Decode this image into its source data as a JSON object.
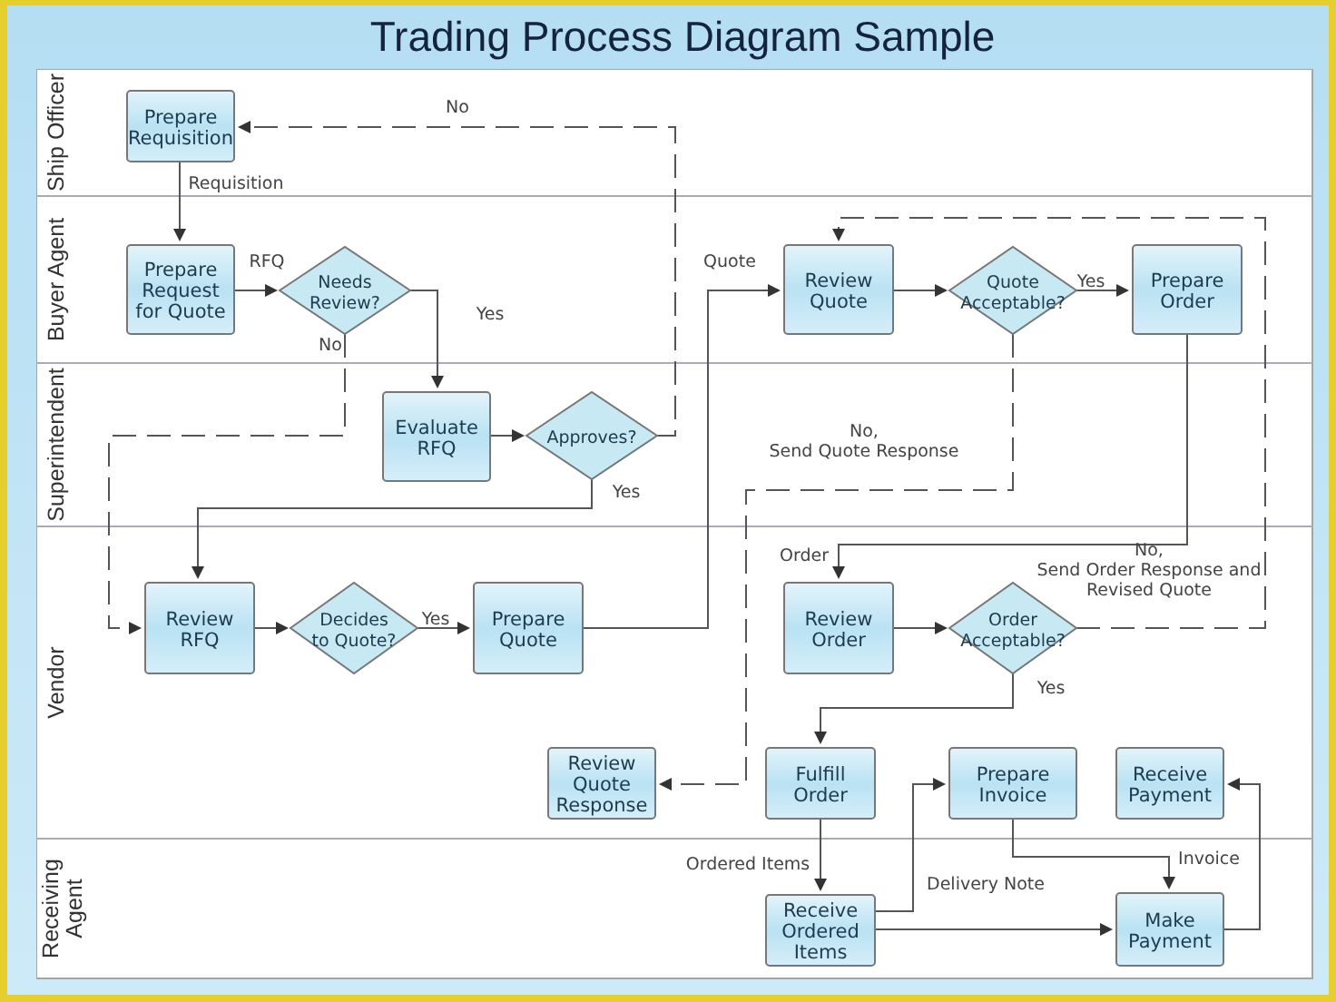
{
  "title": "Trading Process Diagram Sample",
  "lanes": [
    {
      "label": [
        "Ship Officer"
      ]
    },
    {
      "label": [
        "Buyer Agent"
      ]
    },
    {
      "label": [
        "Superintendent"
      ]
    },
    {
      "label": [
        "Vendor"
      ]
    },
    {
      "label": [
        "Receiving",
        "Agent"
      ]
    }
  ],
  "nodes": [
    {
      "kind": "process",
      "lines": [
        "Prepare",
        "Requisition"
      ]
    },
    {
      "kind": "process",
      "lines": [
        "Prepare",
        "Request",
        "for Quote"
      ]
    },
    {
      "kind": "decision",
      "lines": [
        "Needs",
        "Review?"
      ]
    },
    {
      "kind": "process",
      "lines": [
        "Evaluate",
        "RFQ"
      ]
    },
    {
      "kind": "decision",
      "lines": [
        "Approves?"
      ]
    },
    {
      "kind": "process",
      "lines": [
        "Review",
        "RFQ"
      ]
    },
    {
      "kind": "decision",
      "lines": [
        "Decides",
        "to Quote?"
      ]
    },
    {
      "kind": "process",
      "lines": [
        "Prepare",
        "Quote"
      ]
    },
    {
      "kind": "process",
      "lines": [
        "Review",
        "Quote",
        "Response"
      ]
    },
    {
      "kind": "process",
      "lines": [
        "Review",
        "Quote"
      ]
    },
    {
      "kind": "decision",
      "lines": [
        "Quote",
        "Acceptable?"
      ]
    },
    {
      "kind": "process",
      "lines": [
        "Prepare",
        "Order"
      ]
    },
    {
      "kind": "process",
      "lines": [
        "Review",
        "Order"
      ]
    },
    {
      "kind": "decision",
      "lines": [
        "Order",
        "Acceptable?"
      ]
    },
    {
      "kind": "process",
      "lines": [
        "Fulfill",
        "Order"
      ]
    },
    {
      "kind": "process",
      "lines": [
        "Prepare",
        "Invoice"
      ]
    },
    {
      "kind": "process",
      "lines": [
        "Receive",
        "Payment"
      ]
    },
    {
      "kind": "process",
      "lines": [
        "Receive",
        "Ordered",
        "Items"
      ]
    },
    {
      "kind": "process",
      "lines": [
        "Make",
        "Payment"
      ]
    }
  ],
  "edges": [
    {
      "kind": "solid",
      "label": [
        "Requisition"
      ]
    },
    {
      "kind": "solid",
      "label": [
        "RFQ"
      ]
    },
    {
      "kind": "solid",
      "label": [
        "Yes"
      ]
    },
    {
      "kind": "dashed",
      "label": [
        "No"
      ]
    },
    {
      "kind": "solid"
    },
    {
      "kind": "solid",
      "label": [
        "Yes"
      ]
    },
    {
      "kind": "dashed",
      "label": [
        "No"
      ]
    },
    {
      "kind": "solid"
    },
    {
      "kind": "solid",
      "label": [
        "Yes"
      ]
    },
    {
      "kind": "solid",
      "label": [
        "Quote"
      ]
    },
    {
      "kind": "solid"
    },
    {
      "kind": "solid",
      "label": [
        "Yes"
      ]
    },
    {
      "kind": "dashed",
      "label": [
        "No,",
        "Send Quote Response"
      ]
    },
    {
      "kind": "solid",
      "label": [
        "Order"
      ]
    },
    {
      "kind": "solid"
    },
    {
      "kind": "dashed",
      "label": [
        "No,",
        "Send Order Response and",
        "Revised Quote"
      ]
    },
    {
      "kind": "solid",
      "label": [
        "Yes"
      ]
    },
    {
      "kind": "solid",
      "label": [
        "Ordered Items"
      ]
    },
    {
      "kind": "solid",
      "label": [
        "Delivery Note"
      ]
    },
    {
      "kind": "solid"
    },
    {
      "kind": "solid",
      "label": [
        "Invoice"
      ]
    },
    {
      "kind": "solid"
    }
  ]
}
